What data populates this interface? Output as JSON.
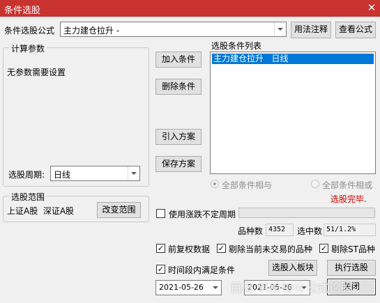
{
  "window": {
    "title": "条件选股",
    "close_glyph": "✕"
  },
  "formula": {
    "label": "条件选股公式",
    "value": "主力建仓拉升 -",
    "usage_btn": "用法注释",
    "view_btn": "查看公式"
  },
  "params": {
    "caption": "计算参数",
    "empty_text": "无参数需要设置",
    "period_label": "选股周期:",
    "period_value": "日线"
  },
  "scope": {
    "caption": "选股范围",
    "markets": "上证A股  深证A股",
    "change_btn": "改变范围"
  },
  "actions": {
    "add": "加入条件",
    "delete": "删除条件",
    "import": "引入方案",
    "save": "保存方案"
  },
  "conditions": {
    "label": "选股条件列表",
    "items": [
      "主力建仓拉升   日线"
    ]
  },
  "logic": {
    "all_and": "全部条件相与",
    "all_or": "全部条件相或",
    "status": "选股完毕.",
    "status_color": "#d00000"
  },
  "volatile_period": {
    "label": "使用涨跌不定周期",
    "checked": false
  },
  "counts": {
    "variety_label": "品种数",
    "variety_value": "4352",
    "selected_label": "选中数",
    "selected_value": "51/1.2%"
  },
  "options": {
    "pre_adjust": {
      "label": "前复权数据",
      "checked": true
    },
    "exclude_untraded": {
      "label": "剔除当前未交易的品种",
      "checked": true
    },
    "exclude_st": {
      "label": "剔除ST品种",
      "checked": true
    },
    "period_satisfy": {
      "label": "时间段内满足条件",
      "checked": true
    }
  },
  "dates": {
    "start": "2021-05-26",
    "end": "2021-05-26"
  },
  "buttons": {
    "to_block": "选股入板块",
    "execute": "执行选股",
    "close": "关闭"
  },
  "watermark": "百度 筑股指标公式论股"
}
